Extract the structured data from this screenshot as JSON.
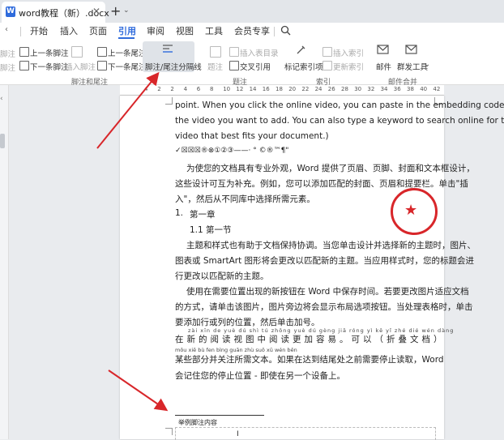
{
  "tab": {
    "title": "word教程（新）.docx",
    "close": "✕",
    "new": "+",
    "new_arrow": "⌄"
  },
  "menu": {
    "items": [
      "开始",
      "插入",
      "页面",
      "引用",
      "审阅",
      "视图",
      "工具",
      "会员专享"
    ],
    "active": "引用",
    "search_icon": "search-icon"
  },
  "ribbon": {
    "prev_footnote": "上一条脚注",
    "next_footnote": "下一条脚注",
    "insert_footnote": "插入脚注",
    "footnote_cut": "脚注",
    "footnote_cut2": "脚注",
    "prev_endnote": "上一条尾注",
    "next_endnote": "下一条尾注",
    "separator_label": "脚注/尾注分隔线",
    "caption": "题注",
    "insert_table_figures": "插入表目录",
    "cross_ref": "交叉引用",
    "mark_index": "标记索引项",
    "insert_index": "插入索引",
    "update_index": "更新索引",
    "mail": "邮件",
    "mail_merge": "邮件合并",
    "tools": "群发工具",
    "tools_arrow": "⌄",
    "group_footnotes": "脚注和尾注",
    "group_caption": "题注",
    "group_index": "索引",
    "group_merge": "邮件合并"
  },
  "ruler": {
    "numbers": [
      "4",
      "2",
      "2",
      "4",
      "6",
      "8",
      "10",
      "12",
      "14",
      "16",
      "18",
      "20",
      "22",
      "24",
      "26",
      "28",
      "30",
      "32",
      "34",
      "36",
      "38",
      "40",
      "42"
    ]
  },
  "page": {
    "en_lines": [
      "point. When you click the online video, you can paste in the embedding code for",
      "the video you want to add. You can also type a keyword to search online for the",
      "video that best fits your document.)"
    ],
    "symbols": "✓☒☒☒®⊗①②③——·   °  ©®™¶\"",
    "para1": [
      "为使您的文档具有专业外观，Word 提供了页眉、页脚、封面和文本框设计，",
      "这些设计可互为补充。例如，您可以添加匹配的封面、页眉和提要栏。单击\"插",
      "入\"，然后从不同库中选择所需元素。"
    ],
    "heading1_num": "1.",
    "heading1": "第一章",
    "heading2": "1.1  第一节",
    "para2": [
      "主题和样式也有助于文档保持协调。当您单击设计并选择新的主题时，图片、",
      "图表或 SmartArt 图形将会更改以匹配新的主题。当应用样式时，您的标题会进",
      "行更改以匹配新的主题。"
    ],
    "para3": [
      "使用在需要位置出现的新按钮在 Word 中保存时间。若要更改图片适应文档",
      "的方式，请单击该图片，图片旁边将会显示布局选项按钮。当处理表格时，单击",
      "要添加行或列的位置，然后单击加号。"
    ],
    "ruby1": "zài  xīn  de  yuè  dú  shì  tú  zhōng  yuè  dú  gèng  jiā  róng  yì     kě    yǐ        zhé  dié  wén  dàng",
    "ruby_line1": "在新的阅读视图中阅读更加容易。可以（折叠文档）",
    "ruby2": "mǒu xiē bù fen bìng guān zhù suǒ xū wén běn",
    "ruby_line2": "某些部分并关注所需文本。如果在达到结尾处之前需要停止读取，Word",
    "last_line": "会记住您的停止位置 - 即使在另一个设备上。",
    "footnote_text": "举例脚注内容",
    "cursor": "I"
  },
  "seal": {
    "star": "★"
  },
  "colors": {
    "accent": "#2f6bdc",
    "arrow": "#d8262a",
    "seal": "#d8262a"
  }
}
